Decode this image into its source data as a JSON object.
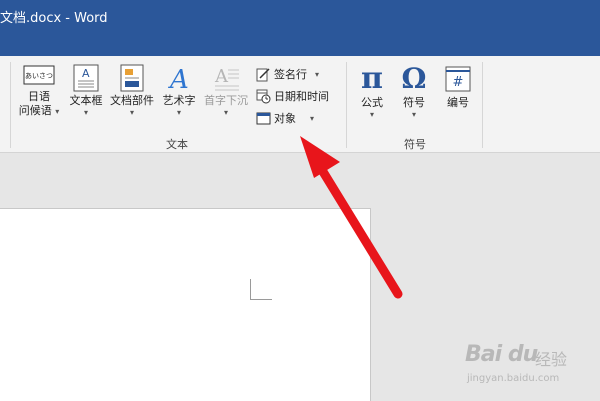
{
  "window": {
    "title": "文档.docx - Word"
  },
  "ribbon": {
    "text_group": {
      "label": "文本",
      "greeting": {
        "line1": "日语",
        "line2": "问候语",
        "caret": "▾",
        "icon_text": "あいさつ"
      },
      "textbox": {
        "label": "文本框",
        "caret": "▾"
      },
      "quickparts": {
        "label": "文档部件",
        "caret": "▾"
      },
      "wordart": {
        "label": "艺术字",
        "caret": "▾"
      },
      "dropcap": {
        "label": "首字下沉",
        "caret": "▾"
      },
      "signature": {
        "label": "签名行",
        "caret": "▾"
      },
      "datetime": {
        "label": "日期和时间"
      },
      "object": {
        "label": "对象",
        "caret": "▾"
      }
    },
    "symbols_group": {
      "label": "符号",
      "equation": {
        "label": "公式",
        "caret": "▾",
        "glyph": "π"
      },
      "symbol": {
        "label": "符号",
        "caret": "▾",
        "glyph": "Ω"
      },
      "number": {
        "label": "编号",
        "glyph": "#"
      }
    }
  },
  "watermark": {
    "brand": "Bai du",
    "cn": "经验",
    "url": "jingyan.baidu.com"
  },
  "colors": {
    "titlebar": "#2b579a",
    "arrow": "#e8151b",
    "ribbon": "#f3f3f3"
  }
}
